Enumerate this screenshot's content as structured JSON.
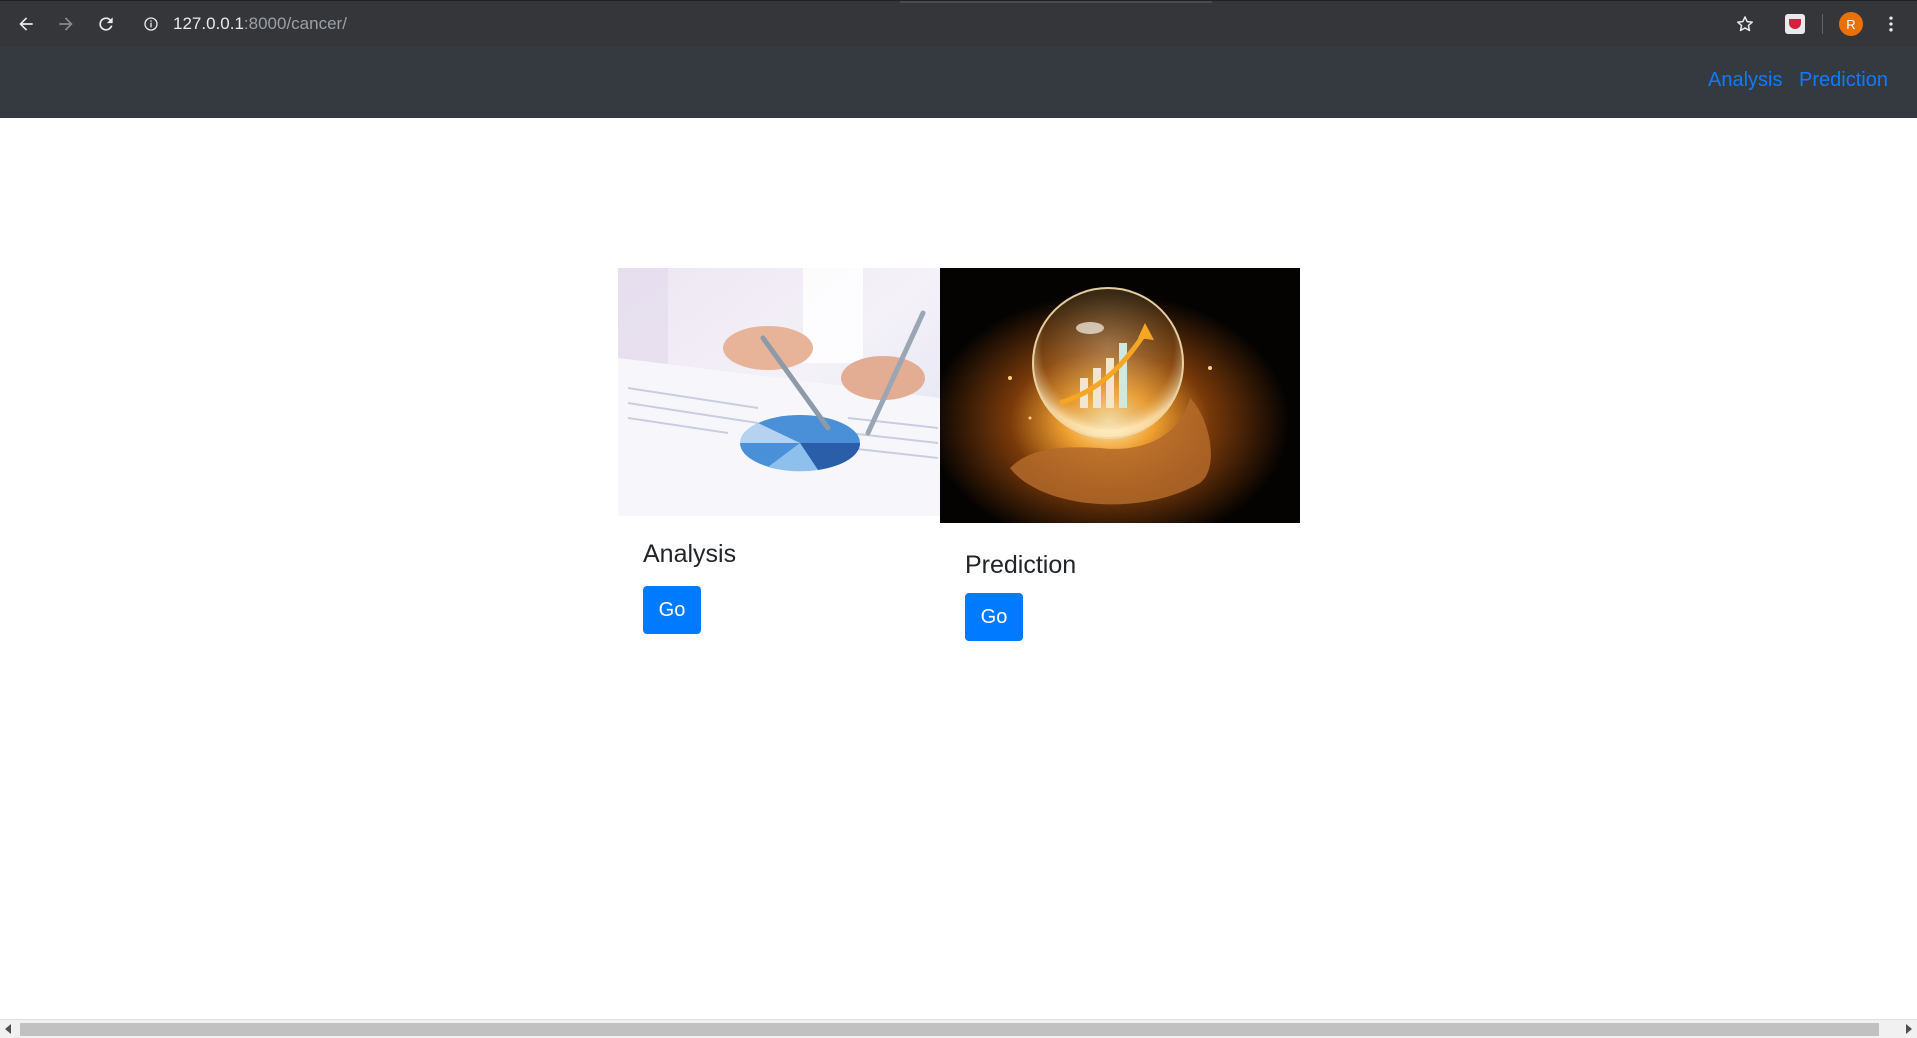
{
  "browser": {
    "url_host": "127.0.0.1",
    "url_path": ":8000/cancer/",
    "profile_initial": "R"
  },
  "navbar": {
    "links": [
      {
        "label": "Analysis"
      },
      {
        "label": "Prediction"
      }
    ]
  },
  "cards": [
    {
      "title": "Analysis",
      "button_label": "Go",
      "image_icon": "pie-chart-analysis-photo"
    },
    {
      "title": "Prediction",
      "button_label": "Go",
      "image_icon": "crystal-ball-growth-photo"
    }
  ],
  "colors": {
    "navbar_bg": "#343a40",
    "link": "#0d7bff",
    "button": "#007bff",
    "browser_chrome": "#35363a"
  }
}
